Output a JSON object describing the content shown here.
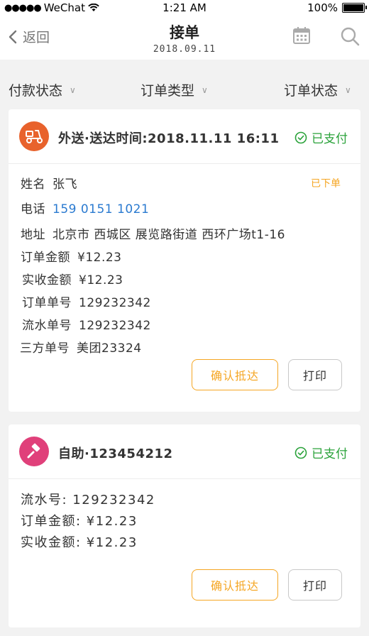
{
  "status_bar": {
    "carrier": "WeChat",
    "time": "1:21 AM",
    "battery": "100%"
  },
  "nav": {
    "back_label": "返回",
    "title": "接单",
    "date": "2018.09.11"
  },
  "filters": [
    {
      "label": "付款状态"
    },
    {
      "label": "订单类型"
    },
    {
      "label": "订单状态"
    }
  ],
  "orders": [
    {
      "icon": "delivery-scooter-icon",
      "icon_color": "#e8622c",
      "title": "外送·送达时间:2018.11.11 16:11",
      "payment_status": "已支付",
      "order_status": "已下单",
      "name_label": "姓名",
      "name": "张飞",
      "phone_label": "电话",
      "phone": "159 0151 1021",
      "address_label": "地址",
      "address": "北京市 西城区 展览路街道 西环广场t1-16",
      "amount_label": "订单金额",
      "amount": "¥12.23",
      "received_label": "实收金额",
      "received": "¥12.23",
      "order_no_label": "订单单号",
      "order_no": "129232342",
      "serial_no_label": "流水单号",
      "serial_no": "129232342",
      "third_no_label": "三方单号",
      "third_no": "美团23324",
      "confirm_label": "确认抵达",
      "print_label": "打印"
    },
    {
      "icon": "hammer-icon",
      "icon_color": "#e0407a",
      "title": "自助·123454212",
      "payment_status": "已支付",
      "serial_line": "流水号: 129232342",
      "amount_line": "订单金额: ¥12.23",
      "received_line": "实收金额: ¥12.23",
      "confirm_label": "确认抵达",
      "print_label": "打印"
    }
  ],
  "colors": {
    "accent": "#f5a623",
    "paid": "#2aa23a",
    "link": "#2a7ad0"
  }
}
